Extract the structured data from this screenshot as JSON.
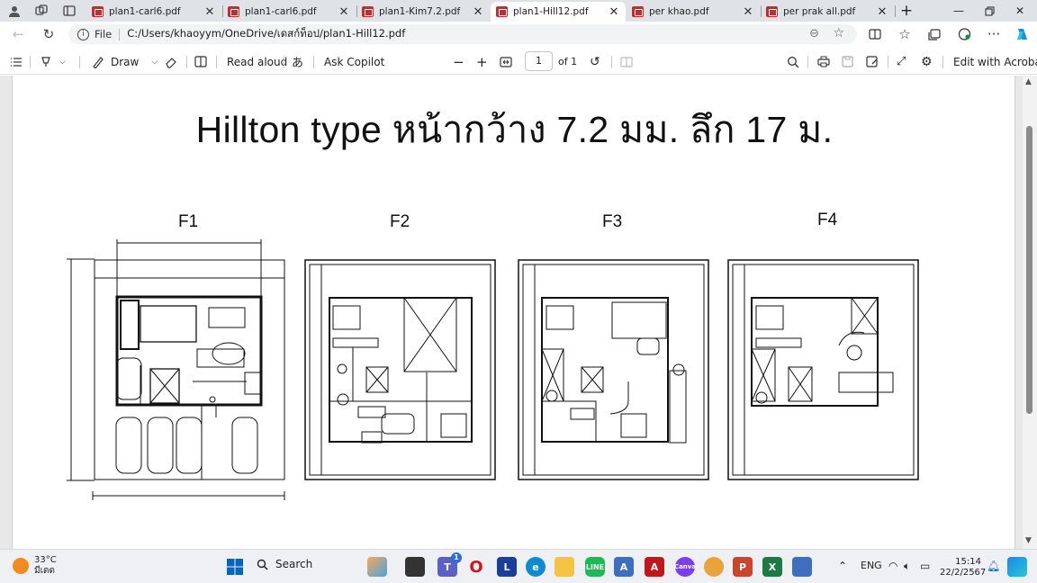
{
  "tabs": [
    {
      "label": "plan1-carl6.pdf",
      "active": false
    },
    {
      "label": "plan1-carl6.pdf",
      "active": false
    },
    {
      "label": "plan1-Kim7.2.pdf",
      "active": false
    },
    {
      "label": "plan1-Hill12.pdf",
      "active": true
    },
    {
      "label": "per khao.pdf",
      "active": false
    },
    {
      "label": "per prak all.pdf",
      "active": false
    }
  ],
  "address": {
    "file_label": "File",
    "url": "C:/Users/khaoyym/OneDrive/เดสก์ท็อป/plan1-Hill12.pdf"
  },
  "pdf_toolbar": {
    "draw_label": "Draw",
    "read_aloud_label": "Read aloud",
    "ask_copilot_label": "Ask Copilot",
    "page_current": "1",
    "page_total": "of 1",
    "edit_acrobat_label": "Edit with Acrobat"
  },
  "document": {
    "title": "Hillton type  หน้ากว้าง 7.2 มม. ลึก 17 ม.",
    "floors": [
      {
        "label": "F1"
      },
      {
        "label": "F2"
      },
      {
        "label": "F3"
      },
      {
        "label": "F4"
      }
    ]
  },
  "taskbar": {
    "weather_temp": "33°C",
    "weather_desc": "มีเดด",
    "search_label": "Search",
    "teams_badge": "1",
    "language": "ENG",
    "time": "15:14",
    "date": "22/2/2567"
  },
  "colors": {
    "tabbar": "#dfe3e8",
    "pdf_icon": "#c6292f",
    "taskbar": "#eef0f4",
    "accent": "#0067c0"
  }
}
